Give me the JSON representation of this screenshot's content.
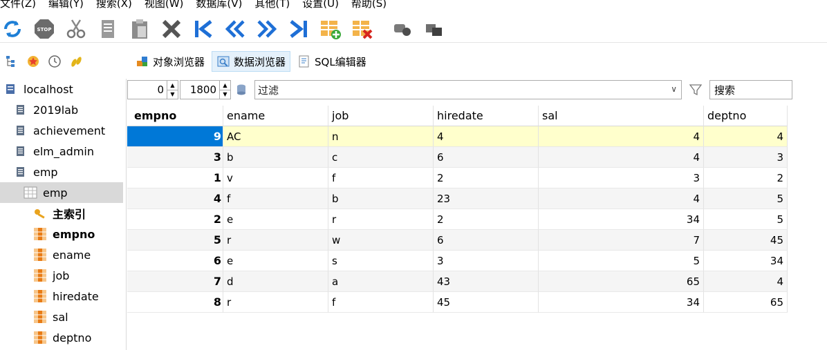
{
  "menu": [
    "文件(Z)",
    "编辑(Y)",
    "搜索(X)",
    "视图(W)",
    "数据库(V)",
    "其他(T)",
    "设置(U)",
    "帮助(S)"
  ],
  "toolbar_icons": [
    "refresh-icon",
    "stop-icon",
    "cut-icon",
    "copy-icon",
    "paste-icon",
    "delete-icon",
    "first-record-icon",
    "previous-page-icon",
    "next-page-icon",
    "last-record-icon",
    "add-row-icon",
    "delete-row-icon",
    "commit-icon",
    "rollback-icon"
  ],
  "tabs": [
    {
      "label": "对象浏览器",
      "icon": "object-browser-icon"
    },
    {
      "label": "数据浏览器",
      "icon": "data-browser-icon"
    },
    {
      "label": "SQL编辑器",
      "icon": "sql-editor-icon"
    }
  ],
  "sidebar": {
    "items": [
      {
        "label": "localhost",
        "icon": "server-icon",
        "level": 0
      },
      {
        "label": "2019lab",
        "icon": "database-icon",
        "level": 1
      },
      {
        "label": "achievement",
        "icon": "database-icon",
        "level": 1
      },
      {
        "label": "elm_admin",
        "icon": "database-icon",
        "level": 1
      },
      {
        "label": "emp",
        "icon": "database-icon",
        "level": 1
      },
      {
        "label": "emp",
        "icon": "table-icon",
        "level": 2
      },
      {
        "label": "主索引",
        "icon": "key-icon",
        "level": 3
      },
      {
        "label": "empno",
        "icon": "column-icon",
        "level": 3
      },
      {
        "label": "ename",
        "icon": "column-icon",
        "level": 3
      },
      {
        "label": "job",
        "icon": "column-icon",
        "level": 3
      },
      {
        "label": "hiredate",
        "icon": "column-icon",
        "level": 3
      },
      {
        "label": "sal",
        "icon": "column-icon",
        "level": 3
      },
      {
        "label": "deptno",
        "icon": "column-icon",
        "level": 3
      }
    ]
  },
  "filter": {
    "offset": "0",
    "limit": "1800",
    "placeholder": "过滤",
    "search_placeholder": "搜索"
  },
  "table": {
    "columns": [
      "empno",
      "ename",
      "job",
      "hiredate",
      "sal",
      "deptno"
    ],
    "rows": [
      [
        "9",
        "AC",
        "n",
        "4",
        "4",
        "4"
      ],
      [
        "3",
        "b",
        "c",
        "6",
        "4",
        "3"
      ],
      [
        "1",
        "v",
        "f",
        "2",
        "3",
        "2"
      ],
      [
        "4",
        "f",
        "b",
        "23",
        "4",
        "5"
      ],
      [
        "2",
        "e",
        "r",
        "2",
        "34",
        "5"
      ],
      [
        "5",
        "r",
        "w",
        "6",
        "7",
        "45"
      ],
      [
        "6",
        "e",
        "s",
        "3",
        "5",
        "34"
      ],
      [
        "7",
        "d",
        "a",
        "43",
        "65",
        "4"
      ],
      [
        "8",
        "r",
        "f",
        "45",
        "34",
        "65"
      ]
    ]
  },
  "colors": {
    "selected_row": "#ffffcc",
    "selected_cell": "#0078d7",
    "alt_row": "#f5f5f5"
  }
}
